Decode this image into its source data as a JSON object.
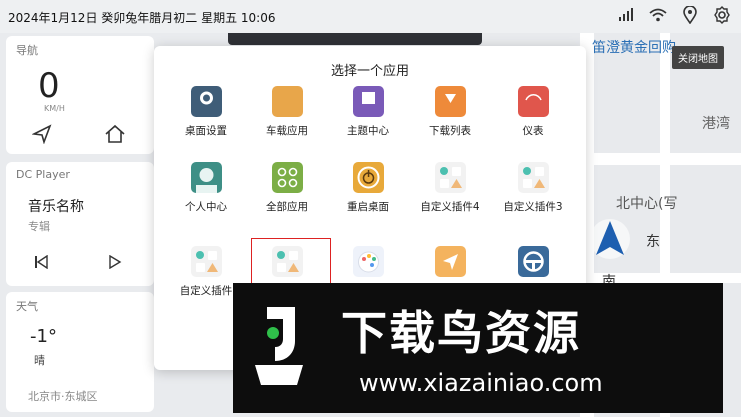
{
  "status_bar": {
    "datetime": "2024年1月12日  癸卯兔年腊月初二  星期五  10:06",
    "icons": [
      "signal-icon",
      "wifi-icon",
      "location-icon",
      "settings-icon"
    ]
  },
  "nav_card": {
    "title": "导航",
    "speed": "0",
    "speed_unit": "KM/H"
  },
  "player_card": {
    "title": "DC Player",
    "song": "音乐名称",
    "album": "专辑"
  },
  "weather_card": {
    "title": "天气",
    "temperature": "-1°",
    "condition": "晴",
    "city": "北京市·东城区"
  },
  "map": {
    "close_button": "关闭地图",
    "labels": [
      "笛澄黄金回购",
      "港湾",
      "北中心(写",
      "东",
      "南"
    ]
  },
  "dialog": {
    "title": "选择一个应用",
    "apps": [
      {
        "label": "桌面设置",
        "color": "#3f5d78"
      },
      {
        "label": "车载应用",
        "color": "#e8a64a"
      },
      {
        "label": "主题中心",
        "color": "#7a5ab8"
      },
      {
        "label": "下载列表",
        "color": "#ee8a3a"
      },
      {
        "label": "仪表",
        "color": "#e0564c"
      },
      {
        "label": "个人中心",
        "color": "#3e8f86"
      },
      {
        "label": "全部应用",
        "color": "#7cae46"
      },
      {
        "label": "重启桌面",
        "color": "#e8a93a"
      },
      {
        "label": "自定义插件4",
        "color": "#f2f2f2"
      },
      {
        "label": "自定义插件3",
        "color": "#f2f2f2"
      },
      {
        "label": "自定义插件",
        "color": "#f2f2f2"
      },
      {
        "label": "",
        "color": "#f2f2f2"
      },
      {
        "label": "",
        "color": "#eef2fa"
      },
      {
        "label": "",
        "color": "#f4b35e"
      },
      {
        "label": "",
        "color": "#3a6a9a"
      }
    ]
  },
  "watermark": {
    "title": "下载鸟资源",
    "url": "www.xiazainiao.com"
  }
}
